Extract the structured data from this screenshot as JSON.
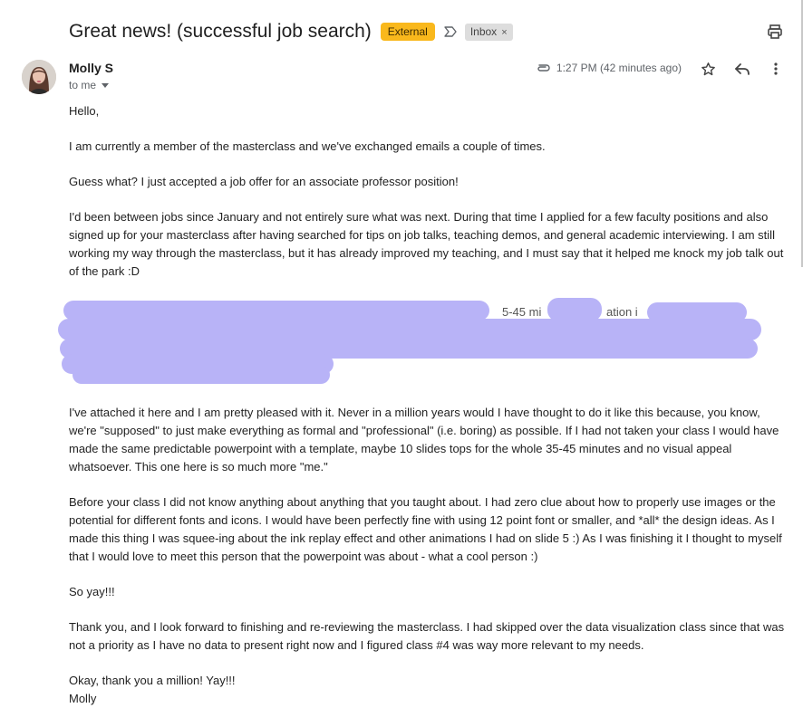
{
  "email": {
    "subject": "Great news! (successful job search)",
    "labels": {
      "external": "External",
      "inbox": "Inbox",
      "remove": "×"
    },
    "sender": {
      "name": "Molly S",
      "recipient_label": "to me"
    },
    "timestamp": "1:27 PM (42 minutes ago)",
    "icons": {
      "important": "important-marker-icon",
      "print": "print-icon",
      "attachment": "attachment-icon",
      "star": "star-icon",
      "reply": "reply-icon",
      "more": "more-vert-icon"
    },
    "colors": {
      "external_badge": "#f9b81c",
      "redaction": "#b8b3f7"
    },
    "body": {
      "greeting": "Hello,",
      "p1": "I am currently a member of the masterclass and we've exchanged emails a couple of times.",
      "p2": "Guess what? I just accepted a job offer for an associate professor position!",
      "p3": "I'd been between jobs since January and not entirely sure what was next. During that time I applied for a few faculty positions and also signed up for your masterclass after having searched for tips on job talks, teaching demos, and general academic interviewing. I am still working my way through the masterclass, but it has already improved my teaching, and I must say that it helped me knock my job talk out of the park :D",
      "redacted_fragments": [
        "5-45 mi",
        "ation i"
      ],
      "p4": "I've attached it here and I am pretty pleased with it. Never in a million years would I have thought to do it like this because, you know, we're \"supposed\" to just make everything as formal and \"professional\" (i.e. boring) as possible. If I had not taken your class I would have made the same predictable powerpoint with a template, maybe 10 slides tops for the whole 35-45 minutes and no visual appeal whatsoever. This one here is so much more \"me.\"",
      "p5": "Before your class I did not know anything about anything that you taught about. I had zero clue about how to properly use images or the potential for different fonts and icons. I would have been perfectly fine with using 12 point font or smaller, and *all* the design ideas. As I made this thing I was squee-ing about the ink replay effect and other animations I had on slide 5 :) As I was finishing it I thought to myself that I would love to meet this person that the powerpoint was about - what a cool person :)",
      "p6": "So yay!!!",
      "p7": "Thank you, and I look forward to finishing and re-reviewing the masterclass. I had skipped over the data visualization class since that was not a priority as I have no data to present right now and I figured class #4 was way more relevant to my needs.",
      "closing": "Okay, thank you a million! Yay!!!",
      "signature": "Molly"
    }
  }
}
